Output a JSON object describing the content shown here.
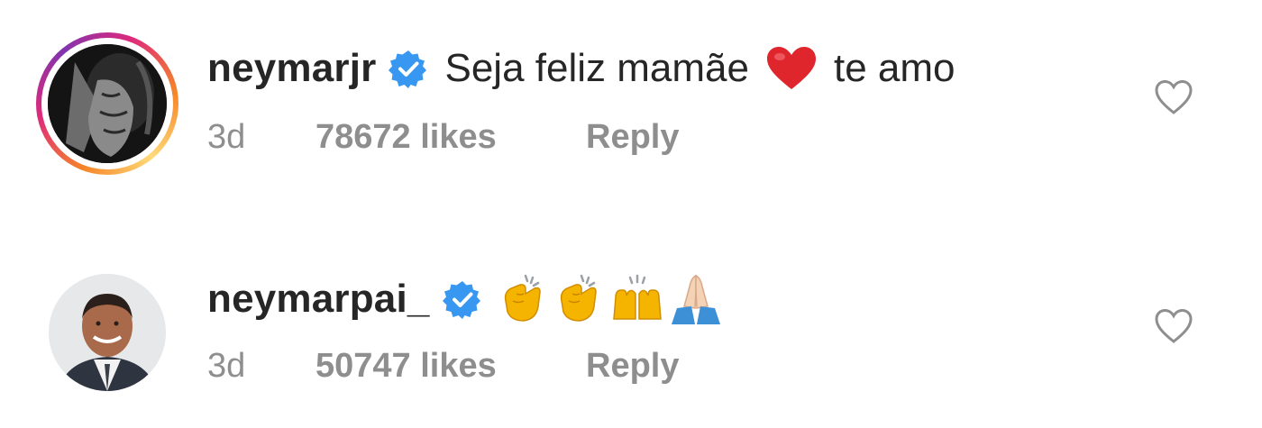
{
  "comments": [
    {
      "username": "neymarjr",
      "verified": true,
      "text_before": "Seja feliz mamãe",
      "emoji": "red-heart",
      "text_after": "te amo",
      "time": "3d",
      "likes": "78672 likes",
      "reply": "Reply",
      "has_story_ring": true
    },
    {
      "username": "neymarpai_",
      "verified": true,
      "emojis": [
        "clapping-hands",
        "clapping-hands",
        "raising-hands",
        "folded-hands"
      ],
      "time": "3d",
      "likes": "50747 likes",
      "reply": "Reply",
      "has_story_ring": false
    }
  ],
  "colors": {
    "username": "#262626",
    "meta": "#8e8e8e",
    "verified": "#3897f0",
    "heart_outline": "#8e8e8e",
    "red_heart": "#e0262d"
  }
}
